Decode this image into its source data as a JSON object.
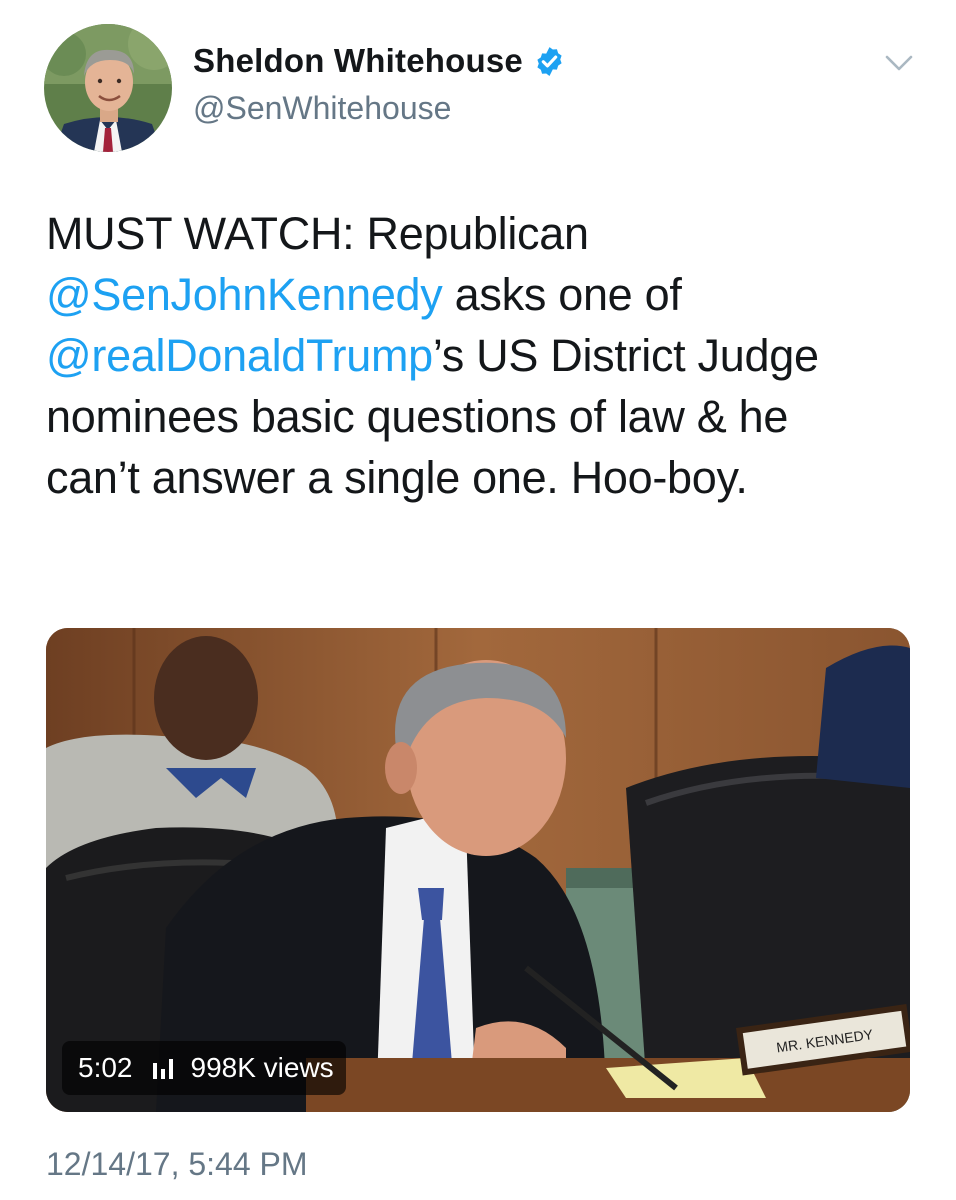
{
  "author": {
    "name": "Sheldon Whitehouse",
    "handle": "@SenWhitehouse",
    "verified": true
  },
  "tweet": {
    "lines": [
      [
        {
          "text": "MUST WATCH: Republican",
          "mention": false
        }
      ],
      [
        {
          "text": "@SenJohnKennedy",
          "mention": true
        },
        {
          "text": " asks one of",
          "mention": false
        }
      ],
      [
        {
          "text": "@realDonaldTrump",
          "mention": true
        },
        {
          "text": "’s US District Judge",
          "mention": false
        }
      ],
      [
        {
          "text": "nominees basic questions of law & he",
          "mention": false
        }
      ],
      [
        {
          "text": "can’t answer a single one. Hoo-boy.",
          "mention": false
        }
      ]
    ]
  },
  "video": {
    "duration": "5:02",
    "views": "998K views",
    "nameplate": "MR. KENNEDY"
  },
  "timestamp": "12/14/17, 5:44 PM",
  "icons": {
    "verified": "verified-badge-icon",
    "menu": "chevron-down-icon",
    "views": "view-count-bars-icon"
  },
  "colors": {
    "link": "#1da1f2",
    "secondary_text": "#657786",
    "primary_text": "#14171a"
  }
}
